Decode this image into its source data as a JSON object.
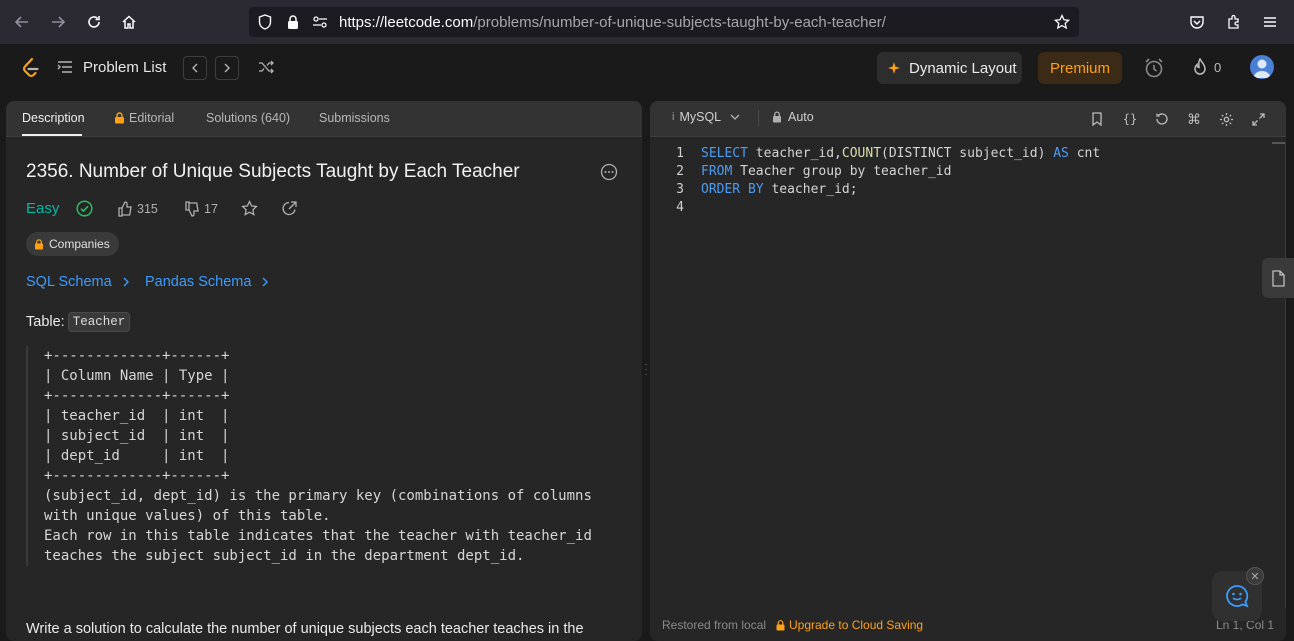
{
  "browser": {
    "url_domain": "https://leetcode.com",
    "url_path": "/problems/number-of-unique-subjects-taught-by-each-teacher/"
  },
  "header": {
    "problem_list": "Problem List",
    "dynamic_layout": "Dynamic Layout",
    "premium": "Premium",
    "streak_count": "0"
  },
  "left": {
    "tabs": [
      "Description",
      "Editorial",
      "Solutions (640)",
      "Submissions"
    ],
    "title": "2356. Number of Unique Subjects Taught by Each Teacher",
    "difficulty": "Easy",
    "likes": "315",
    "dislikes": "17",
    "companies": "Companies",
    "sql_schema": "SQL Schema",
    "pandas_schema": "Pandas Schema",
    "table_label": "Table:",
    "table_name": "Teacher",
    "schema_lines": [
      "+-------------+------+",
      "| Column Name | Type |",
      "+-------------+------+",
      "| teacher_id  | int  |",
      "| subject_id  | int  |",
      "| dept_id     | int  |",
      "+-------------+------+",
      "(subject_id, dept_id) is the primary key (combinations of columns",
      "with unique values) of this table.",
      "Each row in this table indicates that the teacher with teacher_id",
      "teaches the subject subject_id in the department dept_id."
    ],
    "description_cut": "Write a solution to calculate the number of unique subjects each teacher teaches in the"
  },
  "editor": {
    "language": "MySQL",
    "mode": "Auto",
    "line_numbers": [
      "1",
      "2",
      "3",
      "4"
    ],
    "line1": {
      "kw1": "SELECT",
      "t1": " teacher_id,",
      "fn": "COUNT",
      "t2": "(DISTINCT subject_id) ",
      "kw2": "AS",
      "t3": " cnt"
    },
    "line2": {
      "kw1": "FROM",
      "t1": " Teacher group by teacher_id"
    },
    "line3": {
      "kw1": "ORDER BY",
      "t1": " teacher_id;"
    },
    "status_left": "Restored from local",
    "status_upgrade": "Upgrade to Cloud Saving",
    "status_pos": "Ln 1, Col 1"
  },
  "colors": {
    "accent_green": "#00b8a3",
    "premium_orange": "#ffa116",
    "link_blue": "#3b9cff",
    "keyword_blue": "#4e9bf0"
  }
}
